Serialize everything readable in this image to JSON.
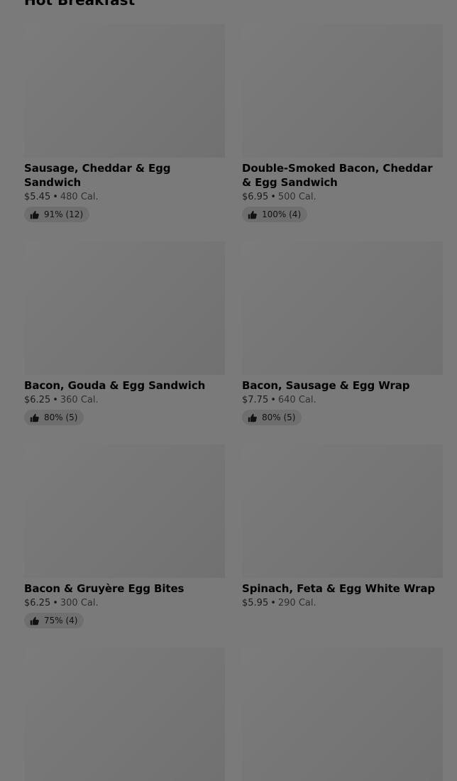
{
  "section": {
    "title": "Hot Breakfast"
  },
  "products": [
    {
      "name": "Sausage, Cheddar & Egg Sandwich",
      "price": "$5.45",
      "calories": "480 Cal.",
      "rating": "91% (12)"
    },
    {
      "name": "Double-Smoked Bacon, Cheddar & Egg Sandwich",
      "price": "$6.95",
      "calories": "500 Cal.",
      "rating": "100% (4)"
    },
    {
      "name": "Bacon, Gouda & Egg Sandwich",
      "price": "$6.25",
      "calories": "360 Cal.",
      "rating": "80% (5)"
    },
    {
      "name": "Bacon, Sausage & Egg Wrap",
      "price": "$7.75",
      "calories": "640 Cal.",
      "rating": "80% (5)"
    },
    {
      "name": "Bacon & Gruyère Egg Bites",
      "price": "$6.25",
      "calories": "300 Cal.",
      "rating": "75% (4)"
    },
    {
      "name": "Spinach, Feta & Egg White Wrap",
      "price": "$5.95",
      "calories": "290 Cal.",
      "rating": null
    },
    {
      "name": null,
      "price": null,
      "calories": null,
      "rating": null
    },
    {
      "name": null,
      "price": null,
      "calories": null,
      "rating": null
    }
  ],
  "separator": "•",
  "icons": {
    "rating": "thumbs-up-icon"
  },
  "colors": {
    "overlay": "#7a7a7a",
    "text": "#000000"
  }
}
